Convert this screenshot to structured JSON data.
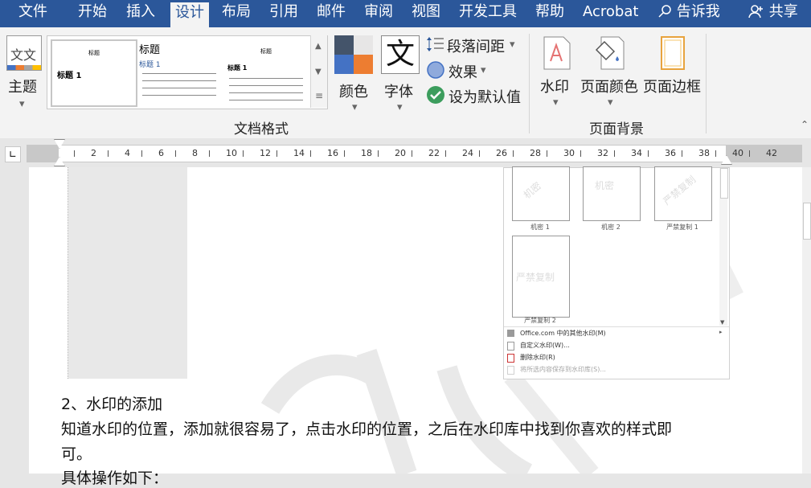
{
  "tabs": {
    "file": "文件",
    "home": "开始",
    "insert": "插入",
    "design": "设计",
    "layout": "布局",
    "references": "引用",
    "mailings": "邮件",
    "review": "审阅",
    "view": "视图",
    "developer": "开发工具",
    "help": "帮助",
    "acrobat": "Acrobat",
    "tellme": "告诉我",
    "share": "共享"
  },
  "ribbon": {
    "themes": "主题",
    "styles": [
      {
        "title": "标题",
        "heading": "标题 1"
      },
      {
        "title": "标题",
        "heading": "标题 1"
      },
      {
        "title": "标题",
        "heading": "标题 1"
      }
    ],
    "colors": "颜色",
    "fonts": "字体",
    "font_sample": "文",
    "theme_sample": "文文",
    "paragraph_spacing": "段落间距",
    "effects": "效果",
    "set_default": "设为默认值",
    "group_document_formatting": "文档格式",
    "watermark": "水印",
    "page_color": "页面颜色",
    "page_borders": "页面边框",
    "group_page_background": "页面背景"
  },
  "ruler": {
    "ticks": [
      "2",
      "4",
      "6",
      "8",
      "10",
      "12",
      "14",
      "16",
      "18",
      "20",
      "22",
      "24",
      "26",
      "28",
      "30",
      "32",
      "34",
      "36",
      "38",
      "40",
      "42"
    ]
  },
  "watermark_gallery": {
    "items": [
      {
        "label": "机密 1",
        "text": "机密"
      },
      {
        "label": "机密 2",
        "text": "机密"
      },
      {
        "label": "严禁复制 1",
        "text": "严禁复制"
      },
      {
        "label": "严禁复制 2",
        "text": "严禁复制"
      }
    ],
    "menu": {
      "more": "Office.com 中的其他水印(M)",
      "custom": "自定义水印(W)...",
      "remove": "删除水印(R)",
      "save": "将所选内容保存到水印库(S)..."
    }
  },
  "document": {
    "line1": "2、水印的添加",
    "line2": "知道水印的位置，添加就很容易了，点击水印的位置，之后在水印库中找到你喜欢的样式即",
    "line3": "可。",
    "line4": "具体操作如下："
  },
  "colors": {
    "accent": "#2b579a",
    "ribbon_bg": "#f3f3f3"
  }
}
